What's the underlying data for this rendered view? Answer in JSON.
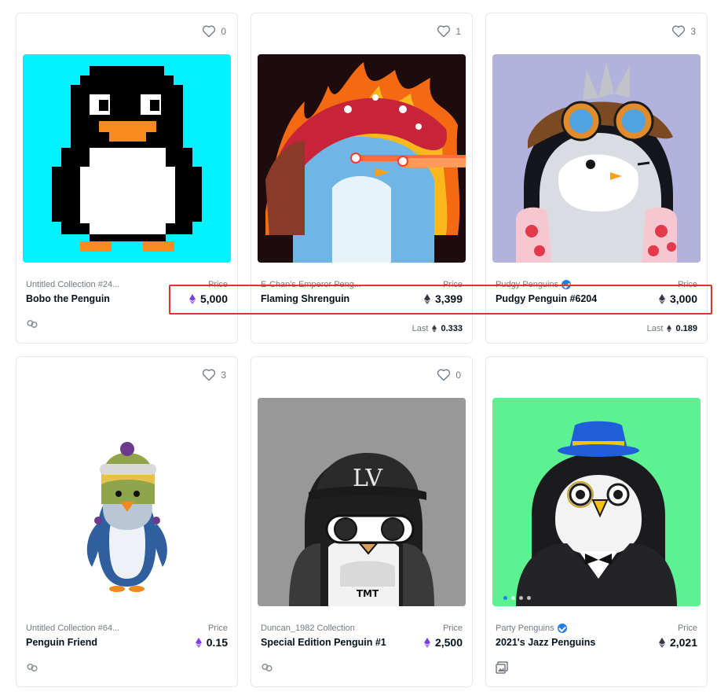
{
  "cards": [
    {
      "likes": "0",
      "collection": "Untitled Collection #24...",
      "verified": false,
      "name": "Bobo the Penguin",
      "price_label": "Price",
      "price": "5,000",
      "price_currency_icon": "eth-purple-icon",
      "footer_icon": "link-icon",
      "last_label": "",
      "last_value": "",
      "image": "pixel-penguin-cyan-background"
    },
    {
      "likes": "1",
      "collection": "E-Chan's Emperor Peng...",
      "verified": false,
      "name": "Flaming Shrenguin",
      "price_label": "Price",
      "price": "3,399",
      "price_currency_icon": "eth-gray-icon",
      "footer_icon": "",
      "last_label": "Last",
      "last_value": "0.333",
      "image": "penguin-mushroom-hat-fire-laser-eyes"
    },
    {
      "likes": "3",
      "collection": "Pudgy Penguins",
      "verified": true,
      "name": "Pudgy Penguin #6204",
      "price_label": "Price",
      "price": "3,000",
      "price_currency_icon": "eth-gray-icon",
      "footer_icon": "",
      "last_label": "Last",
      "last_value": "0.189",
      "image": "penguin-aviator-goggles-floral-shirt"
    },
    {
      "likes": "3",
      "collection": "Untitled Collection #64...",
      "verified": false,
      "name": "Penguin Friend",
      "price_label": "Price",
      "price": "0.15",
      "price_currency_icon": "eth-purple-icon",
      "footer_icon": "link-icon",
      "last_label": "",
      "last_value": "",
      "image": "3d-penguin-winter-hat"
    },
    {
      "likes": "0",
      "collection": "Duncan_1982 Collection",
      "verified": false,
      "name": "Special Edition Penguin #1",
      "price_label": "Price",
      "price": "2,500",
      "price_currency_icon": "eth-purple-icon",
      "footer_icon": "link-icon",
      "last_label": "",
      "last_value": "",
      "image": "grayscale-penguin-cap-glasses",
      "image_text_cap": "LV",
      "image_text_shirt": "TMT"
    },
    {
      "likes": "",
      "collection": "Party Penguins",
      "verified": true,
      "name": "2021's Jazz Penguins",
      "price_label": "Price",
      "price": "2,021",
      "price_currency_icon": "eth-gray-icon",
      "footer_icon": "gallery-icon",
      "last_label": "",
      "last_value": "",
      "image": "tuxedo-penguin-blue-hat-green-background",
      "carousel_dots": 4
    }
  ],
  "colors": {
    "accent_blue": "#2081e2",
    "highlight_red": "#e0342f",
    "eth_purple": "#7b3fe4",
    "eth_gray": "#353840",
    "text_primary": "#04111d",
    "text_secondary": "#707a83"
  },
  "watermark": ""
}
